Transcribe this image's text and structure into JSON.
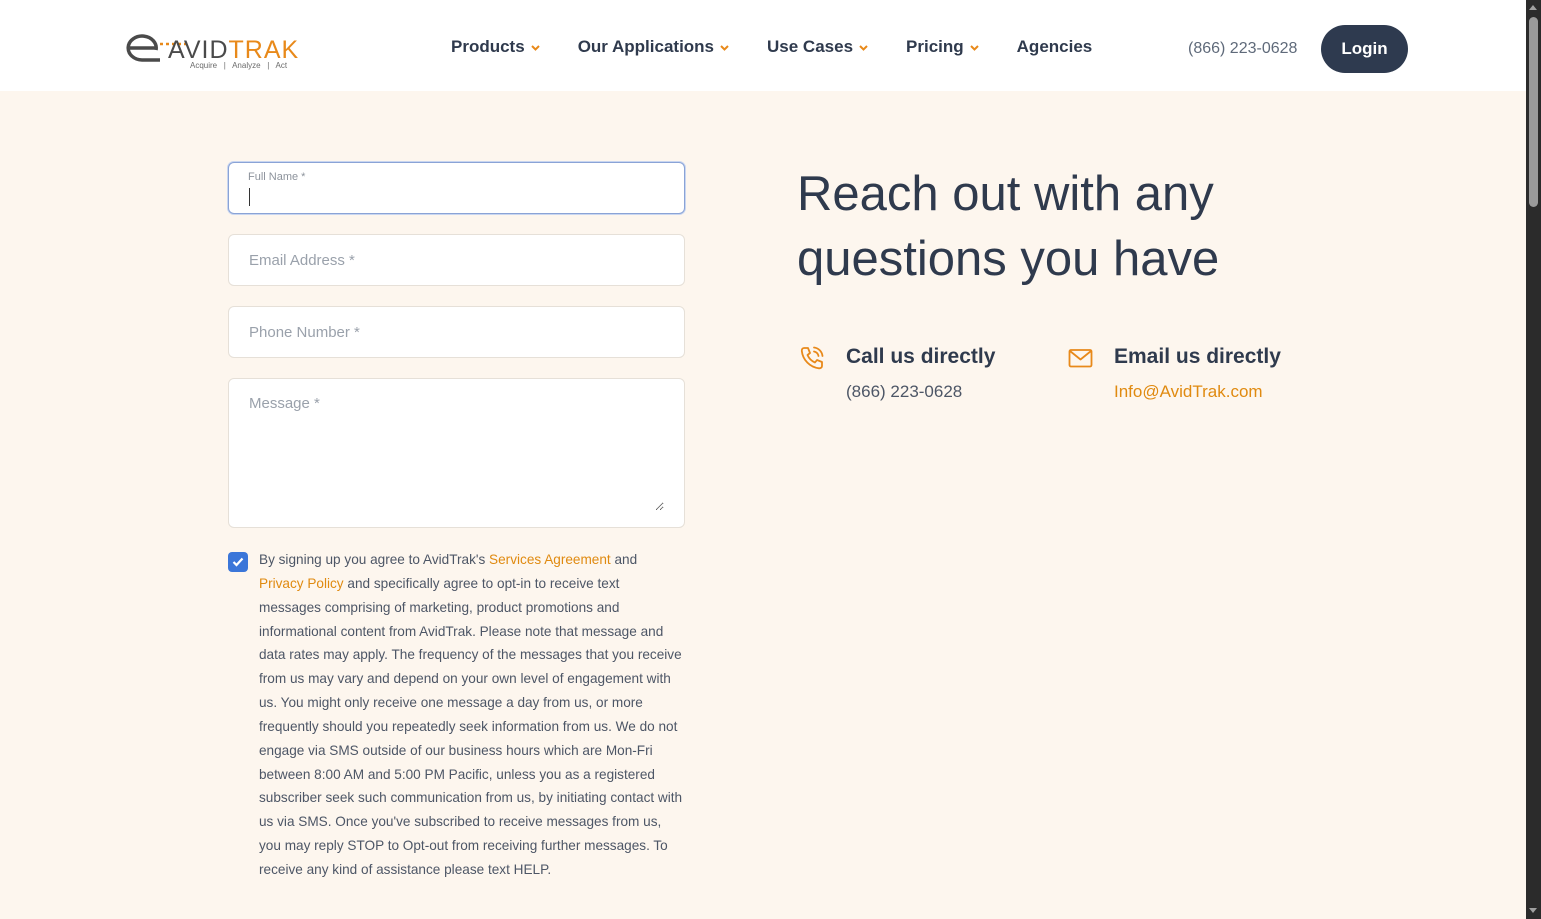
{
  "header": {
    "logo": {
      "brand_a": "AVID",
      "brand_b": "TRAK",
      "tagline": "Acquire   |   Analyze   |   Act"
    },
    "nav": [
      {
        "label": "Products",
        "has_dropdown": true
      },
      {
        "label": "Our Applications",
        "has_dropdown": true
      },
      {
        "label": "Use Cases",
        "has_dropdown": true
      },
      {
        "label": "Pricing",
        "has_dropdown": true
      },
      {
        "label": "Agencies",
        "has_dropdown": false
      }
    ],
    "phone": "(866) 223-0628",
    "login_label": "Login"
  },
  "form": {
    "full_name": {
      "label": "Full Name *",
      "value": ""
    },
    "email": {
      "placeholder": "Email Address *",
      "value": ""
    },
    "phone": {
      "placeholder": "Phone Number *",
      "value": ""
    },
    "message": {
      "placeholder": "Message *",
      "value": ""
    },
    "consent": {
      "checked": true,
      "text_before_link1": "By signing up you agree to AvidTrak's ",
      "link1": "Services Agreement",
      "text_between": " and ",
      "link2": "Privacy Policy",
      "text_after": " and specifically agree to opt-in to receive text messages comprising of marketing, product promotions and informational content from AvidTrak. Please note that message and data rates may apply. The frequency of the messages that you receive from us may vary and depend on your own level of engagement with us. You might only receive one message a day from us, or more frequently should you repeatedly seek information from us. We do not engage via SMS outside of our business hours which are Mon-Fri between 8:00 AM and 5:00 PM Pacific, unless you as a registered subscriber seek such communication from us, by initiating contact with us via SMS. Once you've subscribed to receive messages from us, you may reply STOP to Opt-out from receiving further messages. To receive any kind of assistance please text HELP."
    }
  },
  "contact": {
    "headline_line1": "Reach out with any",
    "headline_line2": "questions you have",
    "call": {
      "title": "Call us directly",
      "value": "(866) 223-0628",
      "icon": "phone-icon"
    },
    "email": {
      "title": "Email us directly",
      "value": "Info@AvidTrak.com",
      "icon": "mail-icon"
    }
  },
  "colors": {
    "accent": "#e8891a",
    "navy": "#2e3a4f",
    "page_bg": "#fdf6ee",
    "checkbox": "#3b76d9"
  }
}
